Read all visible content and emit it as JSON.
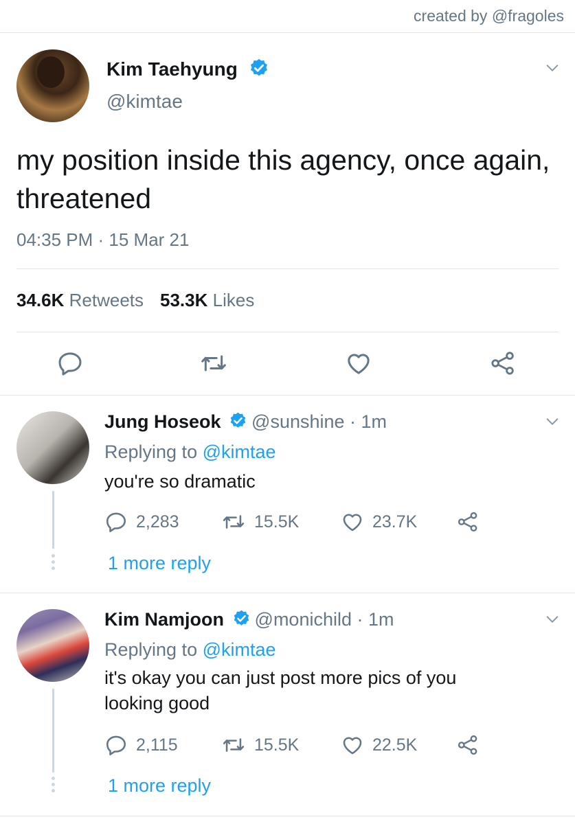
{
  "credit": "created by @fragoles",
  "tweet": {
    "name": "Kim Taehyung",
    "handle": "@kimtae",
    "text": "my position inside this agency, once again, threatened",
    "timestamp": "04:35 PM · 15 Mar 21",
    "retweets_count": "34.6K",
    "retweets_label": "Retweets",
    "likes_count": "53.3K",
    "likes_label": "Likes"
  },
  "replies": [
    {
      "name": "Jung Hoseok",
      "handle": "@sunshine · 1m",
      "replying_prefix": "Replying to ",
      "replying_to": "@kimtae",
      "text": "you're so dramatic",
      "replies_count": "2,283",
      "retweets_count": "15.5K",
      "likes_count": "23.7K",
      "more_replies": "1 more reply"
    },
    {
      "name": "Kim Namjoon",
      "handle": "@monichild · 1m",
      "replying_prefix": "Replying to ",
      "replying_to": "@kimtae",
      "text": "it's okay you can just post more pics of you looking good",
      "replies_count": "2,115",
      "retweets_count": "15.5K",
      "likes_count": "22.5K",
      "more_replies": "1 more reply"
    }
  ],
  "colors": {
    "verified": "#1da1f2",
    "link": "#1da1f2",
    "secondary_text": "#657786",
    "divider": "#e1e8ed"
  },
  "icons": [
    "chevron-down-icon",
    "verified-badge-icon",
    "reply-icon",
    "retweet-icon",
    "like-icon",
    "share-icon"
  ]
}
